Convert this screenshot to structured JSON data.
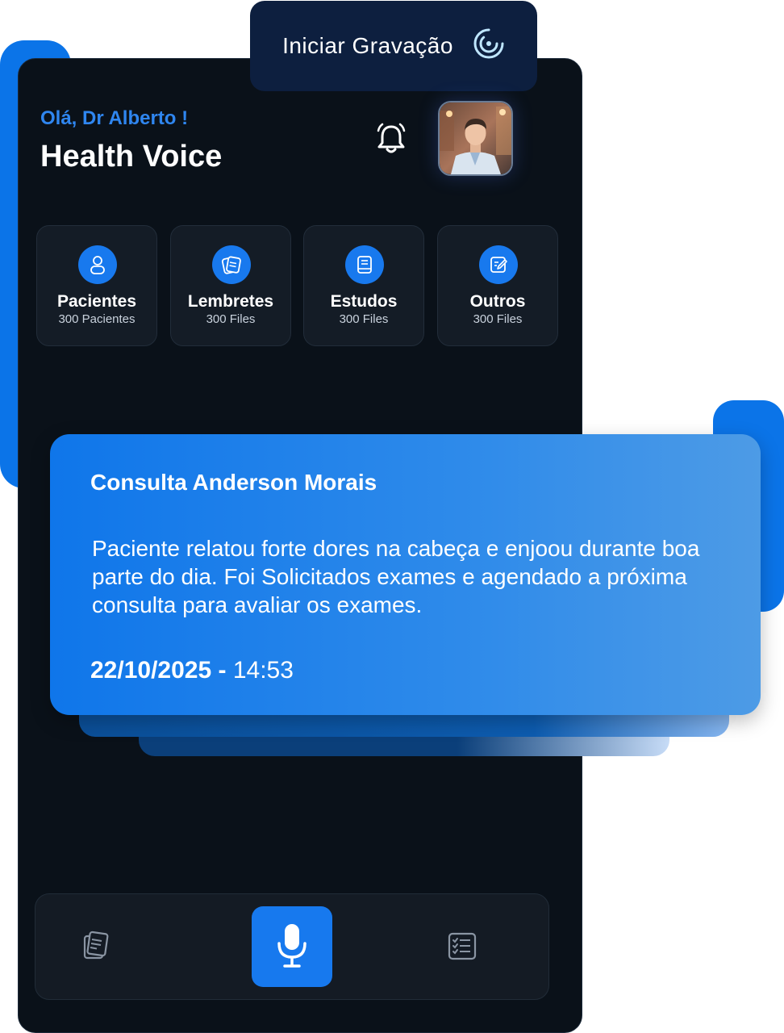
{
  "record": {
    "label": "Iniciar Gravação",
    "icon": "record-spinner-icon"
  },
  "header": {
    "greeting": "Olá, Dr Alberto !",
    "app_title": "Health Voice",
    "bell_icon": "bell-icon",
    "avatar": "doctor-avatar"
  },
  "categories": [
    {
      "title": "Pacientes",
      "subtitle": "300 Pacientes",
      "icon": "user-icon"
    },
    {
      "title": "Lembretes",
      "subtitle": "300 Files",
      "icon": "notes-icon"
    },
    {
      "title": "Estudos",
      "subtitle": "300 Files",
      "icon": "book-icon"
    },
    {
      "title": "Outros",
      "subtitle": "300 Files",
      "icon": "edit-icon"
    }
  ],
  "note": {
    "title": "Consulta Anderson Morais",
    "body": "Paciente relatou forte dores na cabeça e enjoou durante boa parte do dia. Foi Solicitados exames e agendado a próxima consulta para avaliar os exames.",
    "date": "22/10/2025 -",
    "time": "14:53"
  },
  "nav": {
    "left_icon": "documents-icon",
    "center_icon": "microphone-icon",
    "right_icon": "checklist-icon"
  },
  "colors": {
    "accent": "#0b74e8",
    "phone_bg": "#0a1119",
    "greeting": "#2f86f0"
  }
}
